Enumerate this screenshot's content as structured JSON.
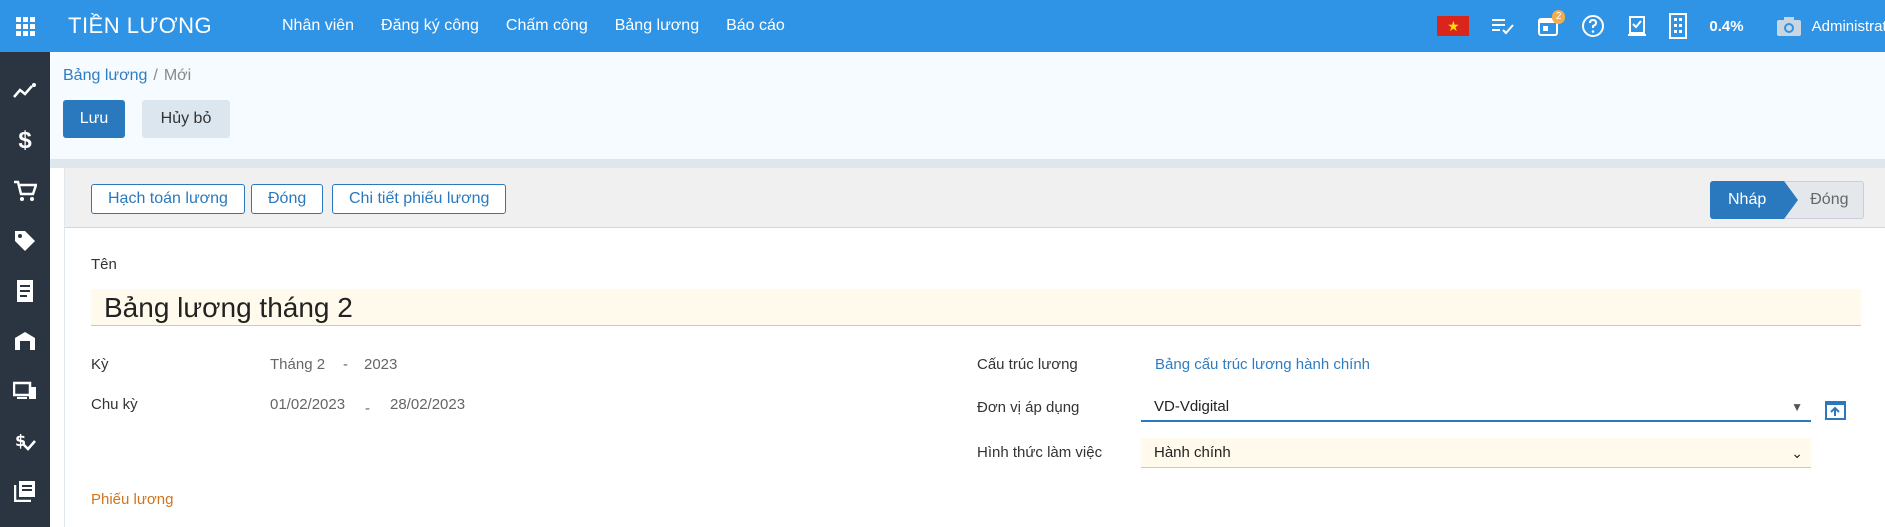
{
  "app": {
    "title": "TIỀN LƯƠNG"
  },
  "menu": [
    "Nhân viên",
    "Đăng ký công",
    "Chấm công",
    "Bảng lương",
    "Báo cáo"
  ],
  "systray": {
    "activity_badge": "2",
    "storage_percent": "0.4%",
    "user_name": "Administrato"
  },
  "breadcrumb": {
    "parent": "Bảng lương",
    "separator": "/",
    "current": "Mới"
  },
  "actions": {
    "save": "Lưu",
    "discard": "Hủy bỏ"
  },
  "statusbar": {
    "buttons": [
      "Hạch toán lương",
      "Đóng",
      "Chi tiết phiếu lương"
    ],
    "stages": {
      "active": "Nháp",
      "next": "Đóng"
    }
  },
  "form": {
    "name_label": "Tên",
    "name_value": "Bảng lương tháng 2",
    "period_label": "Kỳ",
    "period_month": "Tháng 2",
    "period_dash": "-",
    "period_year": "2023",
    "cycle_label": "Chu kỳ",
    "cycle_start": "01/02/2023",
    "cycle_dash": "-",
    "cycle_end": "28/02/2023",
    "structure_label": "Cấu trúc lương",
    "structure_value": "Bảng cấu trúc lương hành chính",
    "unit_label": "Đơn vị áp dụng",
    "unit_value": "VD-Vdigital",
    "work_type_label": "Hình thức làm việc",
    "work_type_value": "Hành chính",
    "payslips_section": "Phiếu lương"
  },
  "colors": {
    "topbar": "#2f93e6",
    "sidebar": "#2a3541",
    "primary": "#2a79bf",
    "section": "#d1741b"
  }
}
